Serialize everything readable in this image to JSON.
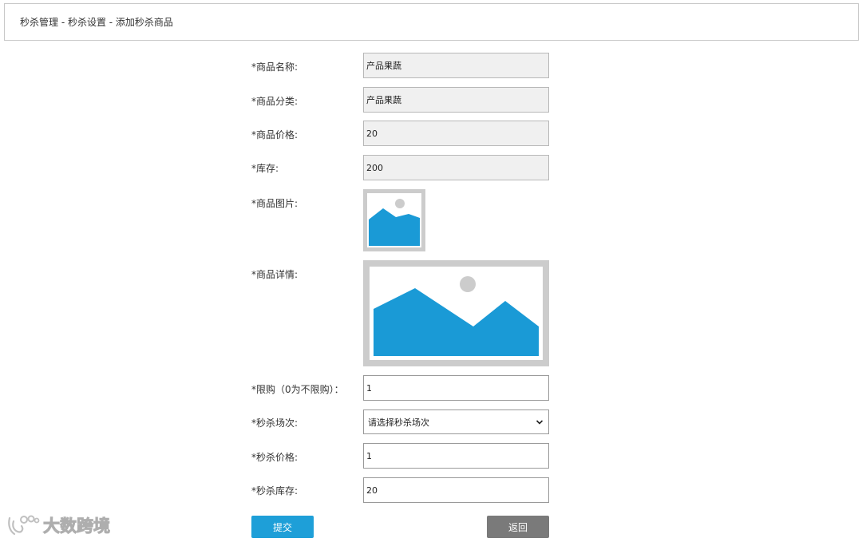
{
  "breadcrumb": {
    "text": "秒杀管理 - 秒杀设置 - 添加秒杀商品"
  },
  "form": {
    "product_name": {
      "label": "*商品名称:",
      "value": "产品果蔬"
    },
    "product_category": {
      "label": "*商品分类:",
      "value": "产品果蔬"
    },
    "product_price": {
      "label": "*商品价格:",
      "value": "20"
    },
    "stock": {
      "label": "*库存:",
      "value": "200"
    },
    "product_image": {
      "label": "*商品图片:"
    },
    "product_detail": {
      "label": "*商品详情:"
    },
    "purchase_limit": {
      "label": "*限购（0为不限购）：",
      "value": "1"
    },
    "flash_session": {
      "label": "*秒杀场次:",
      "selected": "请选择秒杀场次"
    },
    "flash_price": {
      "label": "*秒杀价格:",
      "value": "1"
    },
    "flash_stock": {
      "label": "*秒杀库存:",
      "value": "20"
    }
  },
  "buttons": {
    "submit": "提交",
    "back": "返回"
  },
  "watermark": {
    "text": "大数跨境"
  },
  "colors": {
    "submit_button": "#1e9fd8",
    "back_button": "#7a7a7a",
    "image_placeholder_fill": "#1a9ad6",
    "image_placeholder_frame": "#cccccc"
  },
  "icons": {
    "product_image": "image-placeholder-icon",
    "product_detail": "image-placeholder-icon",
    "select_chevron": "chevron-down-icon",
    "watermark_logo": "logo-icon"
  }
}
